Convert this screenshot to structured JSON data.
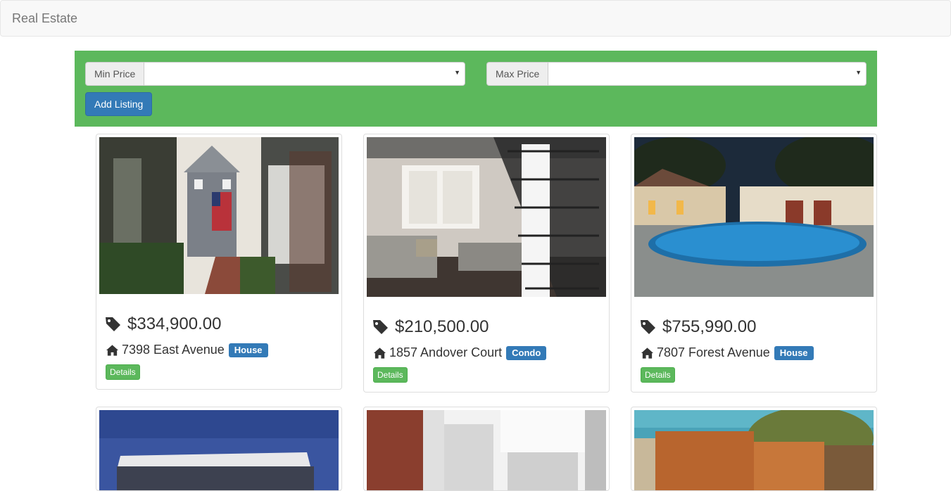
{
  "navbar": {
    "brand": "Real Estate"
  },
  "filters": {
    "min_price_label": "Min Price",
    "min_price_value": "",
    "max_price_label": "Max Price",
    "max_price_value": "",
    "add_listing_label": "Add Listing"
  },
  "listings": [
    {
      "price": "$334,900.00",
      "address": "7398 East Avenue",
      "type": "House",
      "details_label": "Details",
      "image": "house-with-flag-photo"
    },
    {
      "price": "$210,500.00",
      "address": "1857 Andover Court",
      "type": "Condo",
      "details_label": "Details",
      "image": "loft-interior-staircase-photo"
    },
    {
      "price": "$755,990.00",
      "address": "7807 Forest Avenue",
      "type": "House",
      "details_label": "Details",
      "image": "villa-pool-night-photo"
    }
  ],
  "colors": {
    "panel_green": "#5cb85c",
    "primary_blue": "#337ab7",
    "navbar_bg": "#f8f8f8"
  }
}
